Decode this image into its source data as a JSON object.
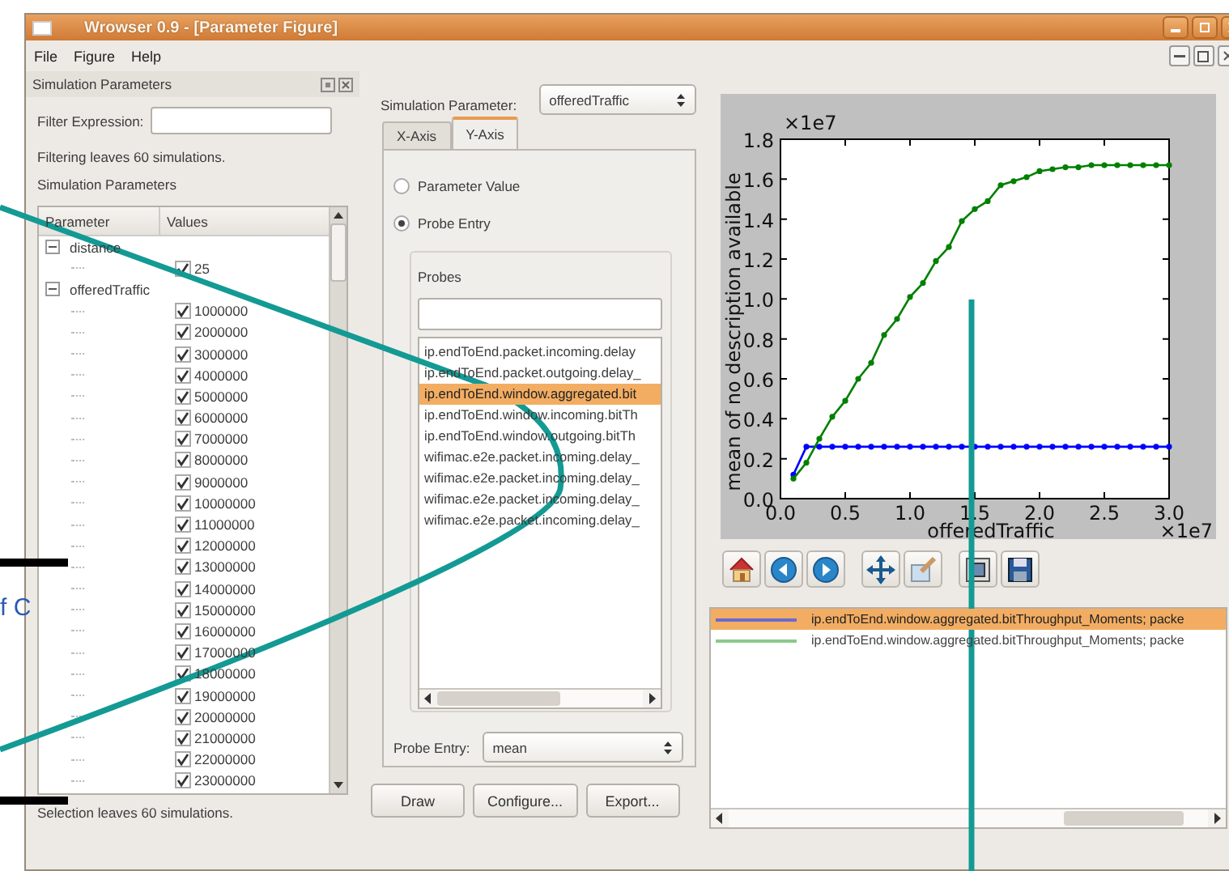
{
  "window": {
    "title": "Wrowser 0.9 - [Parameter Figure]"
  },
  "menu": [
    {
      "label": "File"
    },
    {
      "label": "Figure"
    },
    {
      "label": "Help"
    }
  ],
  "backdrop": {
    "fragment": "f C"
  },
  "parameters_dock": {
    "title": "Simulation Parameters",
    "filter_label": "Filter Expression:",
    "filter_status": "Filtering leaves 60 simulations.",
    "tree_title": "Simulation Parameters",
    "columns": [
      "Parameter",
      "Values"
    ],
    "tree": [
      {
        "label": "distance",
        "expanded": true,
        "children": [
          {
            "value": "25",
            "checked": true
          }
        ]
      },
      {
        "label": "offeredTraffic",
        "expanded": true,
        "children": [
          {
            "value": "1000000",
            "checked": true
          },
          {
            "value": "2000000",
            "checked": true
          },
          {
            "value": "3000000",
            "checked": true
          },
          {
            "value": "4000000",
            "checked": true
          },
          {
            "value": "5000000",
            "checked": true
          },
          {
            "value": "6000000",
            "checked": true
          },
          {
            "value": "7000000",
            "checked": true
          },
          {
            "value": "8000000",
            "checked": true
          },
          {
            "value": "9000000",
            "checked": true
          },
          {
            "value": "10000000",
            "checked": true
          },
          {
            "value": "11000000",
            "checked": true
          },
          {
            "value": "12000000",
            "checked": true
          },
          {
            "value": "13000000",
            "checked": true
          },
          {
            "value": "14000000",
            "checked": true
          },
          {
            "value": "15000000",
            "checked": true
          },
          {
            "value": "16000000",
            "checked": true
          },
          {
            "value": "17000000",
            "checked": true
          },
          {
            "value": "18000000",
            "checked": true
          },
          {
            "value": "19000000",
            "checked": true
          },
          {
            "value": "20000000",
            "checked": true
          },
          {
            "value": "21000000",
            "checked": true
          },
          {
            "value": "22000000",
            "checked": true
          },
          {
            "value": "23000000",
            "checked": true
          }
        ]
      }
    ],
    "selection_status": "Selection leaves 60 simulations."
  },
  "axis_panel": {
    "parameter_label": "Simulation Parameter:",
    "parameter_value": "offeredTraffic",
    "tabs": [
      {
        "label": "X-Axis",
        "selected": false
      },
      {
        "label": "Y-Axis",
        "selected": true
      }
    ],
    "radios": [
      {
        "label": "Parameter Value",
        "selected": false
      },
      {
        "label": "Probe Entry",
        "selected": true
      }
    ],
    "probes_title": "Probes",
    "probes": [
      {
        "label": "ip.endToEnd.packet.incoming.delay",
        "selected": false
      },
      {
        "label": "ip.endToEnd.packet.outgoing.delay_",
        "selected": false
      },
      {
        "label": "ip.endToEnd.window.aggregated.bit",
        "selected": true
      },
      {
        "label": "ip.endToEnd.window.incoming.bitTh",
        "selected": false
      },
      {
        "label": "ip.endToEnd.window.outgoing.bitTh",
        "selected": false
      },
      {
        "label": "wifimac.e2e.packet.incoming.delay_",
        "selected": false
      },
      {
        "label": "wifimac.e2e.packet.incoming.delay_",
        "selected": false
      },
      {
        "label": "wifimac.e2e.packet.incoming.delay_",
        "selected": false
      },
      {
        "label": "wifimac.e2e.packet.incoming.delay_",
        "selected": false
      }
    ],
    "entry_label": "Probe Entry:",
    "entry_value": "mean",
    "buttons": [
      "Draw",
      "Configure...",
      "Export..."
    ]
  },
  "plot": {
    "x_multiplier": "×1e7",
    "y_multiplier": "×1e7",
    "chart_data": {
      "type": "line",
      "xlabel": "offeredTraffic",
      "ylabel": "mean of no description available",
      "x": [
        0.1,
        0.2,
        0.3,
        0.4,
        0.5,
        0.6,
        0.7,
        0.8,
        0.9,
        1.0,
        1.1,
        1.2,
        1.3,
        1.4,
        1.5,
        1.6,
        1.7,
        1.8,
        1.9,
        2.0,
        2.1,
        2.2,
        2.3,
        2.4,
        2.5,
        2.6,
        2.7,
        2.8,
        2.9,
        3.0
      ],
      "series": [
        {
          "color": "#0000ff",
          "marker": "circle",
          "values": [
            0.12,
            0.26,
            0.26,
            0.26,
            0.26,
            0.26,
            0.26,
            0.26,
            0.26,
            0.26,
            0.26,
            0.26,
            0.26,
            0.26,
            0.26,
            0.26,
            0.26,
            0.26,
            0.26,
            0.26,
            0.26,
            0.26,
            0.26,
            0.26,
            0.26,
            0.26,
            0.26,
            0.26,
            0.26,
            0.26
          ]
        },
        {
          "color": "#008000",
          "marker": "circle",
          "values": [
            0.1,
            0.18,
            0.3,
            0.41,
            0.49,
            0.6,
            0.68,
            0.82,
            0.9,
            1.01,
            1.08,
            1.19,
            1.26,
            1.39,
            1.45,
            1.49,
            1.57,
            1.59,
            1.61,
            1.64,
            1.65,
            1.66,
            1.66,
            1.67,
            1.67,
            1.67,
            1.67,
            1.67,
            1.67,
            1.67
          ]
        }
      ],
      "xlim": [
        0,
        3
      ],
      "ylim": [
        0,
        1.8
      ],
      "xticks": [
        {
          "value": 0,
          "label": "0.0"
        },
        {
          "value": 0.5,
          "label": "0.5"
        },
        {
          "value": 1,
          "label": "1.0"
        },
        {
          "value": 1.5,
          "label": "1.5"
        },
        {
          "value": 2,
          "label": "2.0"
        },
        {
          "value": 2.5,
          "label": "2.5"
        },
        {
          "value": 3,
          "label": "3.0"
        }
      ],
      "yticks": [
        {
          "value": 0,
          "label": "0.0"
        },
        {
          "value": 0.2,
          "label": "0.2"
        },
        {
          "value": 0.4,
          "label": "0.4"
        },
        {
          "value": 0.6,
          "label": "0.6"
        },
        {
          "value": 0.8,
          "label": "0.8"
        },
        {
          "value": 1,
          "label": "1.0"
        },
        {
          "value": 1.2,
          "label": "1.2"
        },
        {
          "value": 1.4,
          "label": "1.4"
        },
        {
          "value": 1.6,
          "label": "1.6"
        },
        {
          "value": 1.8,
          "label": "1.8"
        }
      ]
    },
    "legend": [
      {
        "label": "ip.endToEnd.window.aggregated.bitThroughput_Moments; packe",
        "color": "#6a6ad0",
        "selected": true
      },
      {
        "label": "ip.endToEnd.window.aggregated.bitThroughput_Moments; packe",
        "color": "#8cc88c",
        "selected": false
      }
    ]
  }
}
